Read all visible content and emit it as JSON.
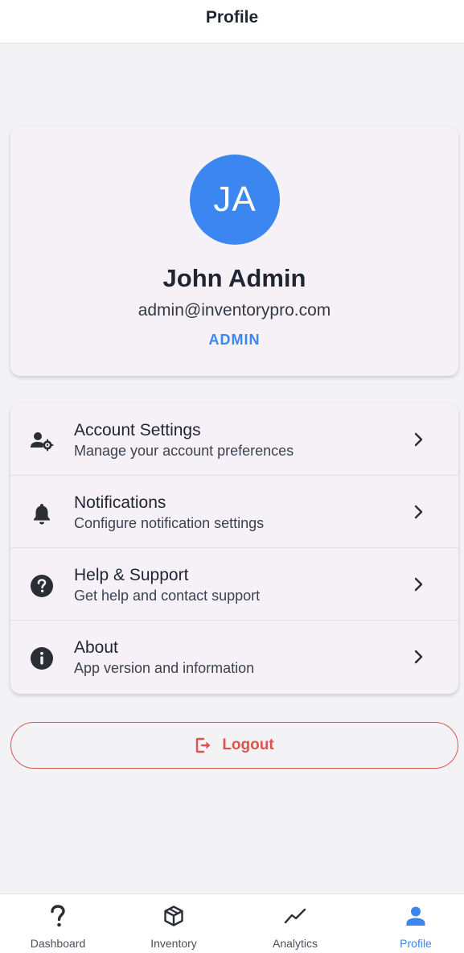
{
  "header": {
    "title": "Profile"
  },
  "profile": {
    "initials": "JA",
    "name": "John Admin",
    "email": "admin@inventorypro.com",
    "role": "ADMIN",
    "avatar_color": "#3b86f0"
  },
  "menu": {
    "items": [
      {
        "title": "Account Settings",
        "subtitle": "Manage your account preferences",
        "icon": "user-gear-icon"
      },
      {
        "title": "Notifications",
        "subtitle": "Configure notification settings",
        "icon": "bell-icon"
      },
      {
        "title": "Help & Support",
        "subtitle": "Get help and contact support",
        "icon": "help-circle-icon"
      },
      {
        "title": "About",
        "subtitle": "App version and information",
        "icon": "info-circle-icon"
      }
    ]
  },
  "logout": {
    "label": "Logout",
    "color": "#e0534d",
    "icon": "logout-icon"
  },
  "bottom_nav": {
    "items": [
      {
        "label": "Dashboard",
        "icon": "question-icon",
        "active": false
      },
      {
        "label": "Inventory",
        "icon": "box-icon",
        "active": false
      },
      {
        "label": "Analytics",
        "icon": "trend-line-icon",
        "active": false
      },
      {
        "label": "Profile",
        "icon": "person-icon",
        "active": true
      }
    ],
    "active_color": "#3b86f0"
  }
}
